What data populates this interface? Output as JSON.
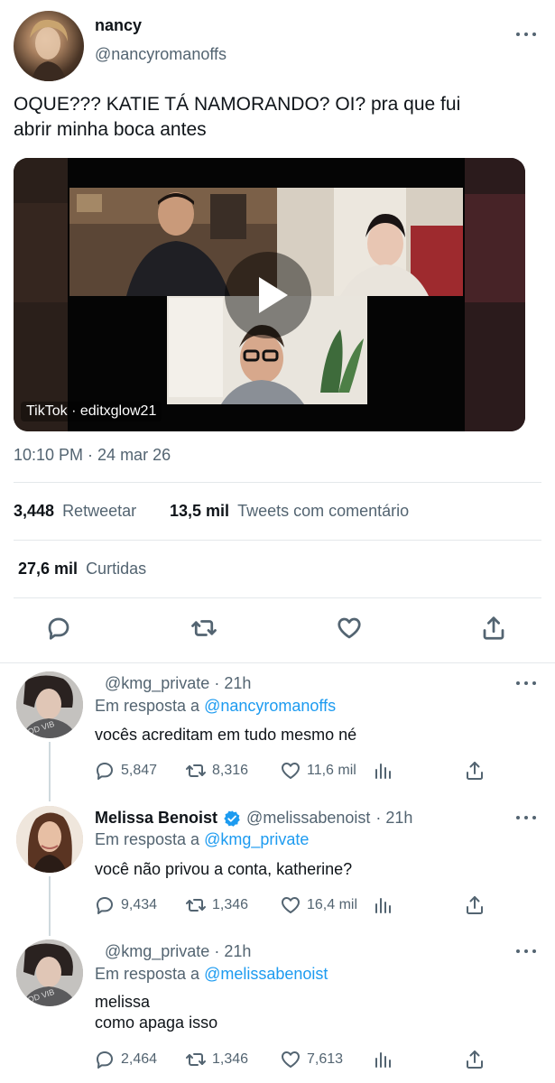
{
  "main_tweet": {
    "display_name": "nancy",
    "handle": "@nancyromanoffs",
    "text_line1": "OQUE??? KATIE TÁ NAMORANDO? OI? pra que fui",
    "text_line2": "abrir minha boca antes",
    "video_source_label": "TikTok · editxglow21",
    "timestamp": "10:10 PM · 24 mar 26",
    "retweets_count": "3,448",
    "retweets_label": "Retweetar",
    "quotes_count": "13,5 mil",
    "quotes_label": "Tweets com comentário",
    "likes_count": "27,6 mil",
    "likes_label": "Curtidas"
  },
  "replies": [
    {
      "display_name": "",
      "handle": "@kmg_private",
      "time": "· 21h",
      "reply_prefix": "Em resposta a",
      "reply_to": "@nancyromanoffs",
      "text_line1": "vocês acreditam em tudo mesmo né",
      "text_line2": "",
      "replies": "5,847",
      "retweets": "8,316",
      "likes": "11,6 mil"
    },
    {
      "display_name": "Melissa Benoist",
      "handle": "@melissabenoist",
      "time": "· 21h",
      "reply_prefix": "Em resposta a",
      "reply_to": "@kmg_private",
      "text_line1": "você não privou a conta, katherine?",
      "text_line2": "",
      "replies": "9,434",
      "retweets": "1,346",
      "likes": "16,4 mil"
    },
    {
      "display_name": "",
      "handle": "@kmg_private",
      "time": "· 21h",
      "reply_prefix": "Em resposta a",
      "reply_to": "@melissabenoist",
      "text_line1": "melissa",
      "text_line2": "como apaga isso",
      "replies": "2,464",
      "retweets": "1,346",
      "likes": "7,613"
    }
  ],
  "icons": {
    "reply": "reply-icon",
    "retweet": "retweet-icon",
    "like": "heart-icon",
    "analytics": "analytics-icon",
    "share": "share-icon",
    "verified": "verified-badge-icon",
    "more": "more-icon",
    "play": "play-icon"
  },
  "colors": {
    "link": "#1d9bf0",
    "secondary_text": "#536471",
    "verified": "#1d9bf0"
  }
}
